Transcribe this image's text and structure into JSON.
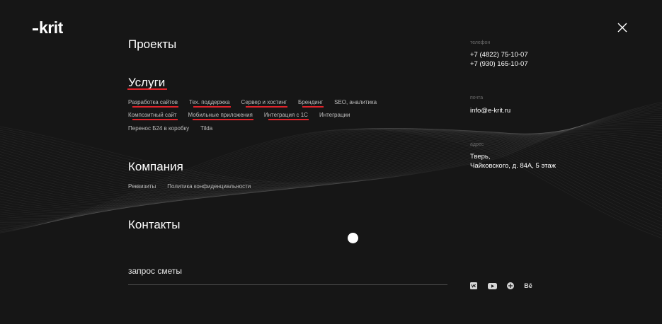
{
  "logo": "krit",
  "menu": {
    "projects": "Проекты",
    "services": {
      "title": "Услуги",
      "rows": [
        [
          {
            "label": "Разработка сайтов",
            "underlined": true
          },
          {
            "label": "Тех. поддержка",
            "underlined": true
          },
          {
            "label": "Сервер и хостинг",
            "underlined": true
          },
          {
            "label": "Брендинг",
            "underlined": true
          },
          {
            "label": "SEO, аналитика",
            "underlined": false
          }
        ],
        [
          {
            "label": "Композитный сайт",
            "underlined": true
          },
          {
            "label": "Мобильные приложения",
            "underlined": true
          },
          {
            "label": "Интеграция с 1С",
            "underlined": true
          },
          {
            "label": "Интеграции",
            "underlined": false
          }
        ],
        [
          {
            "label": "Перенос Б24 в коробку",
            "underlined": false
          },
          {
            "label": "Tilda",
            "underlined": false
          }
        ]
      ]
    },
    "company": {
      "title": "Компания",
      "links": [
        "Реквизиты",
        "Политика конфиденциальности"
      ]
    },
    "contacts": "Контакты",
    "request": "запрос сметы"
  },
  "contact": {
    "phone_label": "телефон",
    "phones": [
      "+7 (4822) 75-10-07",
      "+7 (930) 165-10-07"
    ],
    "email_label": "почта",
    "email": "info@e-krit.ru",
    "address_label": "адрес",
    "address": [
      "Тверь,",
      "Чайковского, д. 84А, 5 этаж"
    ]
  },
  "social": {
    "icons": [
      "vk-icon",
      "youtube-icon",
      "dribbble-icon",
      "behance-icon"
    ],
    "behance_text": "Bē"
  },
  "colors": {
    "background": "#161616",
    "accent": "#e1232a",
    "text": "#ffffff",
    "muted": "#6b6b6b"
  }
}
